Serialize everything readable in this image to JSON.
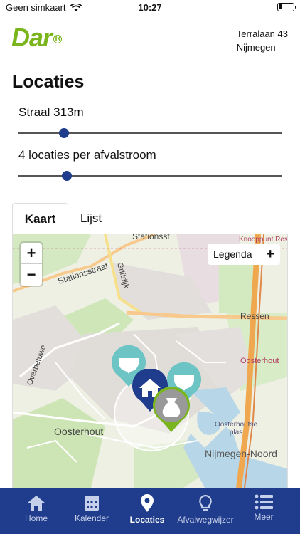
{
  "status": {
    "carrier": "Geen simkaart",
    "time": "10:27"
  },
  "header": {
    "logo": "Dar",
    "address_line1": "Terralaan 43",
    "address_line2": "Nijmegen"
  },
  "page": {
    "title": "Locaties"
  },
  "sliders": [
    {
      "label": "Straal 313m",
      "value_fraction": 0.16
    },
    {
      "label": "4 locaties per afvalstroom",
      "value_fraction": 0.17
    }
  ],
  "tabs": {
    "map": "Kaart",
    "list": "Lijst",
    "active": "Kaart"
  },
  "map": {
    "zoom_in": "+",
    "zoom_out": "−",
    "legend": "Legenda",
    "legend_toggle": "+",
    "labels": {
      "stationsstraat": "Stationsstraat",
      "stationsstr_top": "Stationsst",
      "knooppunt": "Knooppunt Res",
      "griftdijk": "Griftdijk",
      "ressen": "Ressen",
      "overbetuwe": "Overbetuwe",
      "oosterhout_east": "Oosterhout",
      "oosterhout_west": "Oosterhout",
      "plas": "Oosterhoutse plas",
      "nijmegen_noord": "Nijmegen-Noord"
    },
    "colors": {
      "diaper_pin": "#6cc4c4",
      "home_pin": "#1f3d8c",
      "bag_pin": "#7ab51d",
      "road": "#f7c98c",
      "highway": "#f0a850",
      "water": "#b7d6e8"
    }
  },
  "tabbar": {
    "active": "Locaties",
    "items": [
      {
        "label": "Home",
        "icon": "home-icon"
      },
      {
        "label": "Kalender",
        "icon": "calendar-icon"
      },
      {
        "label": "Locaties",
        "icon": "location-pin-icon"
      },
      {
        "label": "Afvalwegwijzer",
        "icon": "lightbulb-icon"
      },
      {
        "label": "Meer",
        "icon": "menu-list-icon"
      }
    ]
  }
}
